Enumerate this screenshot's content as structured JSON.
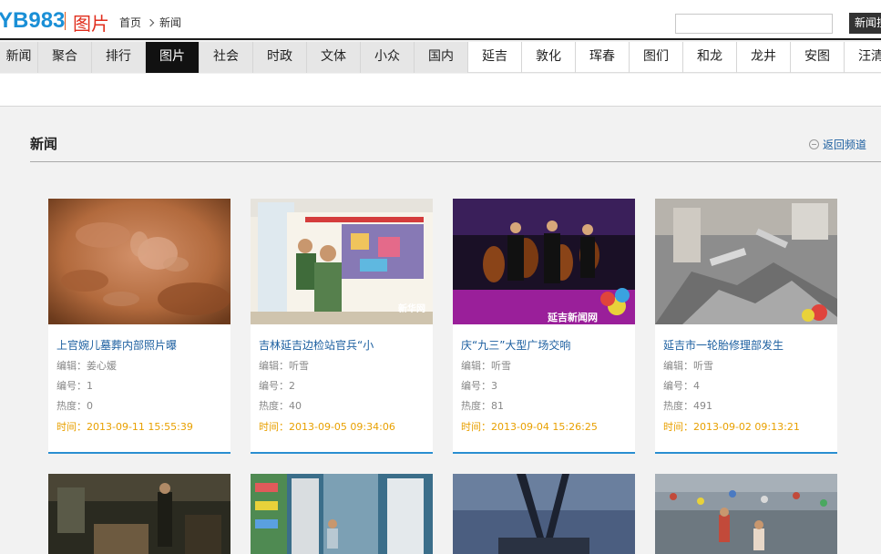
{
  "header": {
    "logo": "YB983",
    "logo_sub": "图片",
    "breadcrumb": [
      "首页",
      "新闻"
    ],
    "search_placeholder": "",
    "search_button": "新闻搜"
  },
  "nav": {
    "items": [
      {
        "label": "新闻",
        "state": "gray"
      },
      {
        "label": "聚合",
        "state": "gray"
      },
      {
        "label": "排行",
        "state": "gray"
      },
      {
        "label": "图片",
        "state": "active"
      },
      {
        "label": "社会",
        "state": "gray"
      },
      {
        "label": "时政",
        "state": "gray"
      },
      {
        "label": "文体",
        "state": "gray"
      },
      {
        "label": "小众",
        "state": "gray"
      },
      {
        "label": "国内",
        "state": "gray"
      },
      {
        "label": "延吉",
        "state": "white"
      },
      {
        "label": "敦化",
        "state": "white"
      },
      {
        "label": "珲春",
        "state": "white"
      },
      {
        "label": "图们",
        "state": "white"
      },
      {
        "label": "和龙",
        "state": "white"
      },
      {
        "label": "龙井",
        "state": "white"
      },
      {
        "label": "安图",
        "state": "white"
      },
      {
        "label": "汪清",
        "state": "white"
      }
    ]
  },
  "section": {
    "title": "新闻",
    "back_link": "返回频道"
  },
  "cards": [
    {
      "title": "上官婉儿墓葬内部照片曝",
      "editor": "编辑：姜心媛",
      "number": "编号：1",
      "heat": "热度：0",
      "time": "时间：2013-09-11 15:55:39"
    },
    {
      "title": "吉林延吉边检站官兵“小",
      "editor": "编辑：听雪",
      "number": "编号：2",
      "heat": "热度：40",
      "time": "时间：2013-09-05 09:34:06",
      "watermark": "新华网"
    },
    {
      "title": "庆“九三”大型广场交响",
      "editor": "编辑：听雪",
      "number": "编号：3",
      "heat": "热度：81",
      "time": "时间：2013-09-04 15:26:25",
      "watermark": "延吉新闻网"
    },
    {
      "title": "延吉市一轮胎修理部发生",
      "editor": "编辑：听雪",
      "number": "编号：4",
      "heat": "热度：491",
      "time": "时间：2013-09-02 09:13:21"
    }
  ]
}
